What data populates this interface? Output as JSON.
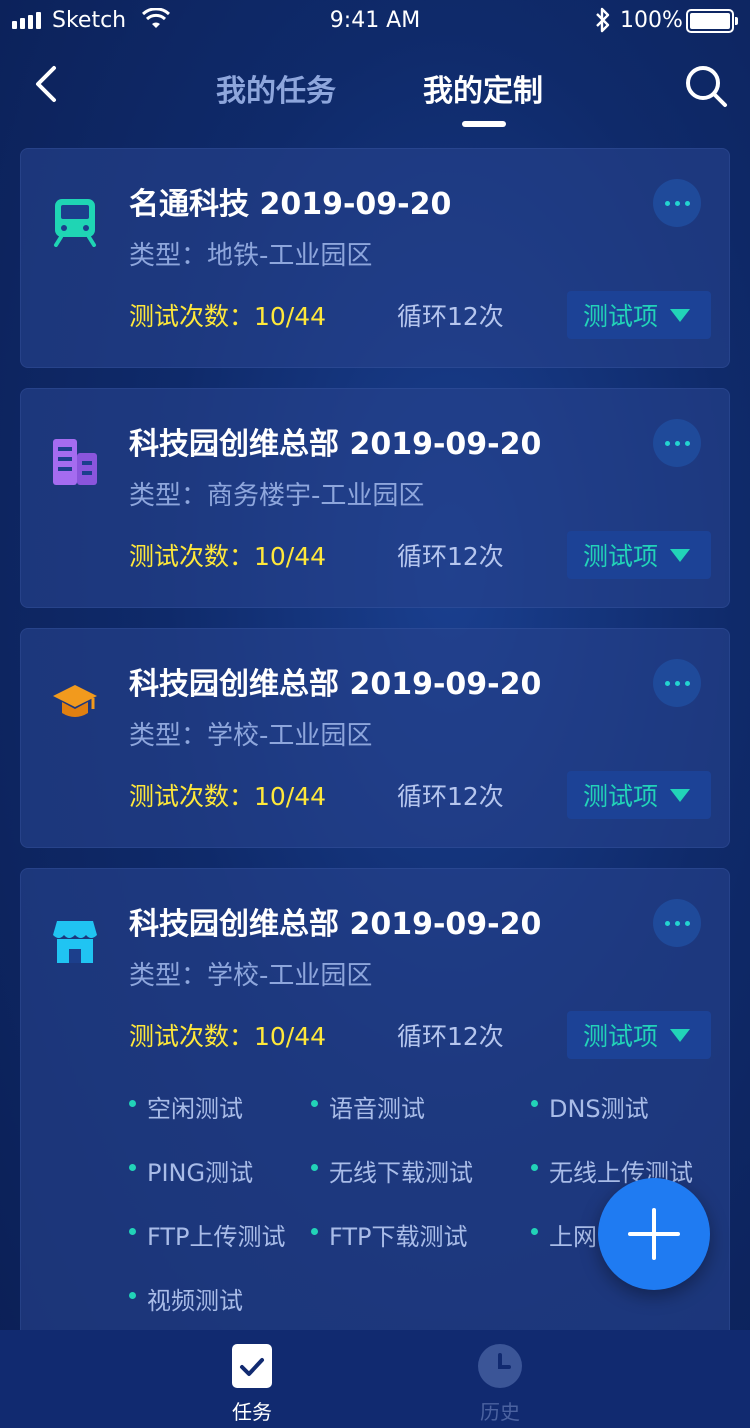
{
  "status_bar": {
    "carrier": "Sketch",
    "time": "9:41 AM",
    "battery": "100%"
  },
  "nav": {
    "tab_tasks": "我的任务",
    "tab_custom": "我的定制",
    "active_tab": "我的定制"
  },
  "cards": [
    {
      "title": "名通科技   2019-09-20",
      "type": "类型：地铁-工业园区",
      "count": "测试次数：10/44",
      "cycle": "循环12次",
      "test_label": "测试项",
      "icon": "train-icon",
      "icon_color": "#1fd5b4"
    },
    {
      "title": "科技园创维总部   2019-09-20",
      "type": "类型：商务楼宇-工业园区",
      "count": "测试次数：10/44",
      "cycle": "循环12次",
      "test_label": "测试项",
      "icon": "building-icon",
      "icon_color": "#a56cf0"
    },
    {
      "title": "科技园创维总部   2019-09-20",
      "type": "类型：学校-工业园区",
      "count": "测试次数：10/44",
      "cycle": "循环12次",
      "test_label": "测试项",
      "icon": "graduation-cap-icon",
      "icon_color": "#f29a1d"
    },
    {
      "title": "科技园创维总部   2019-09-20",
      "type": "类型：学校-工业园区",
      "count": "测试次数：10/44",
      "cycle": "循环12次",
      "test_label": "测试项",
      "icon": "store-icon",
      "icon_color": "#20c4f2",
      "expanded": true,
      "tests": [
        "空闲测试",
        "语音测试",
        "DNS测试",
        "PING测试",
        "无线下载测试",
        "无线上传测试",
        "FTP上传测试",
        "FTP下载测试",
        "上网",
        "视频测试"
      ]
    }
  ],
  "tabbar": {
    "tasks": "任务",
    "history": "历史"
  },
  "colors": {
    "background": "#0f2a6a",
    "accent_teal": "#22d3b8",
    "count_yellow": "#ffe83a",
    "fab_blue": "#1f7bf2"
  }
}
